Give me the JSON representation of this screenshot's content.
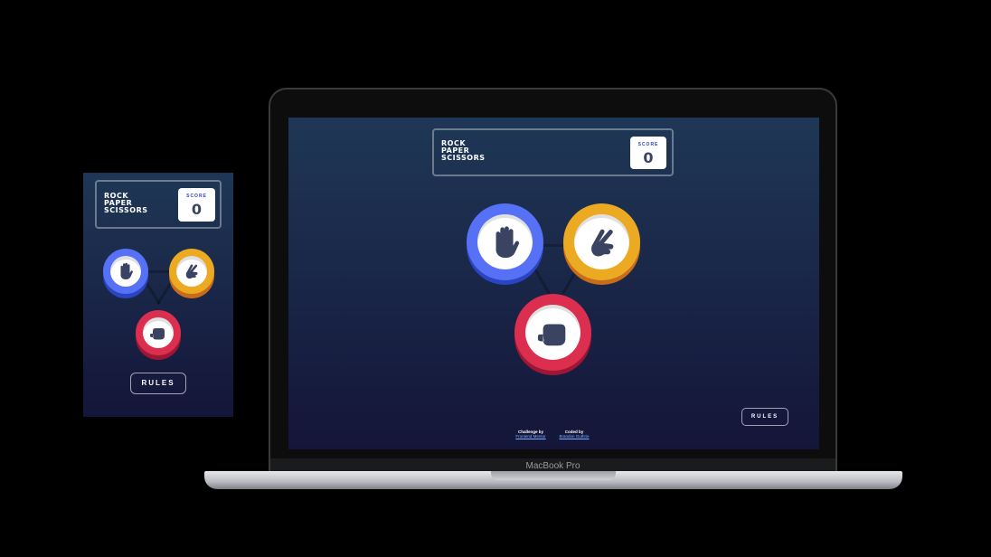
{
  "game": {
    "title_lines": [
      "ROCK",
      "PAPER",
      "SCISSORS"
    ],
    "score_label": "SCORE",
    "score_value": "0",
    "rules_label": "RULES",
    "choices": [
      {
        "name": "paper",
        "icon": "hand-paper-icon",
        "color": "#5671f5"
      },
      {
        "name": "scissors",
        "icon": "hand-scissors-icon",
        "color": "#eca922"
      },
      {
        "name": "rock",
        "icon": "hand-rock-icon",
        "color": "#dc2e4e"
      }
    ]
  },
  "attribution": {
    "challenge_label": "Challenge by",
    "challenge_link": "Frontend Mentor",
    "coded_label": "Coded by",
    "coded_link": "Brandon Guthrie"
  },
  "device": {
    "laptop_label": "MacBook Pro"
  }
}
